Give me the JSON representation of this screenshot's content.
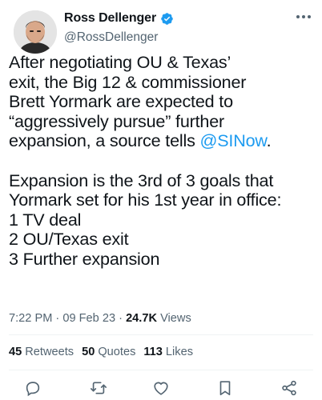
{
  "author": {
    "display_name": "Ross Dellenger",
    "handle": "@RossDellenger",
    "verified_badge_color": "#1d9bf0"
  },
  "tweet": {
    "text_before_mention": "After negotiating OU & Texas’\nexit, the Big 12 & commissioner\nBrett Yormark are expected to\n“aggressively pursue” further\nexpansion, a source tells ",
    "mention": "@SINow",
    "text_after_mention": ".\n\nExpansion is the 3rd of 3 goals that\nYormark set for his 1st year in office:\n1 TV deal\n2 OU/Texas exit\n3 Further expansion",
    "mention_color": "#1d9bf0"
  },
  "meta": {
    "time": "7:22 PM",
    "sep": " · ",
    "date": "09 Feb 23",
    "sep2": " · ",
    "views_count": "24.7K",
    "views_label": "Views"
  },
  "stats": {
    "retweets_count": "45",
    "retweets_label": "Retweets",
    "quotes_count": "50",
    "quotes_label": "Quotes",
    "likes_count": "113",
    "likes_label": "Likes"
  },
  "icons": {
    "more": "more-horizontal-icon",
    "reply": "reply-icon",
    "retweet": "retweet-icon",
    "like": "heart-icon",
    "bookmark": "bookmark-icon",
    "share": "share-icon"
  }
}
